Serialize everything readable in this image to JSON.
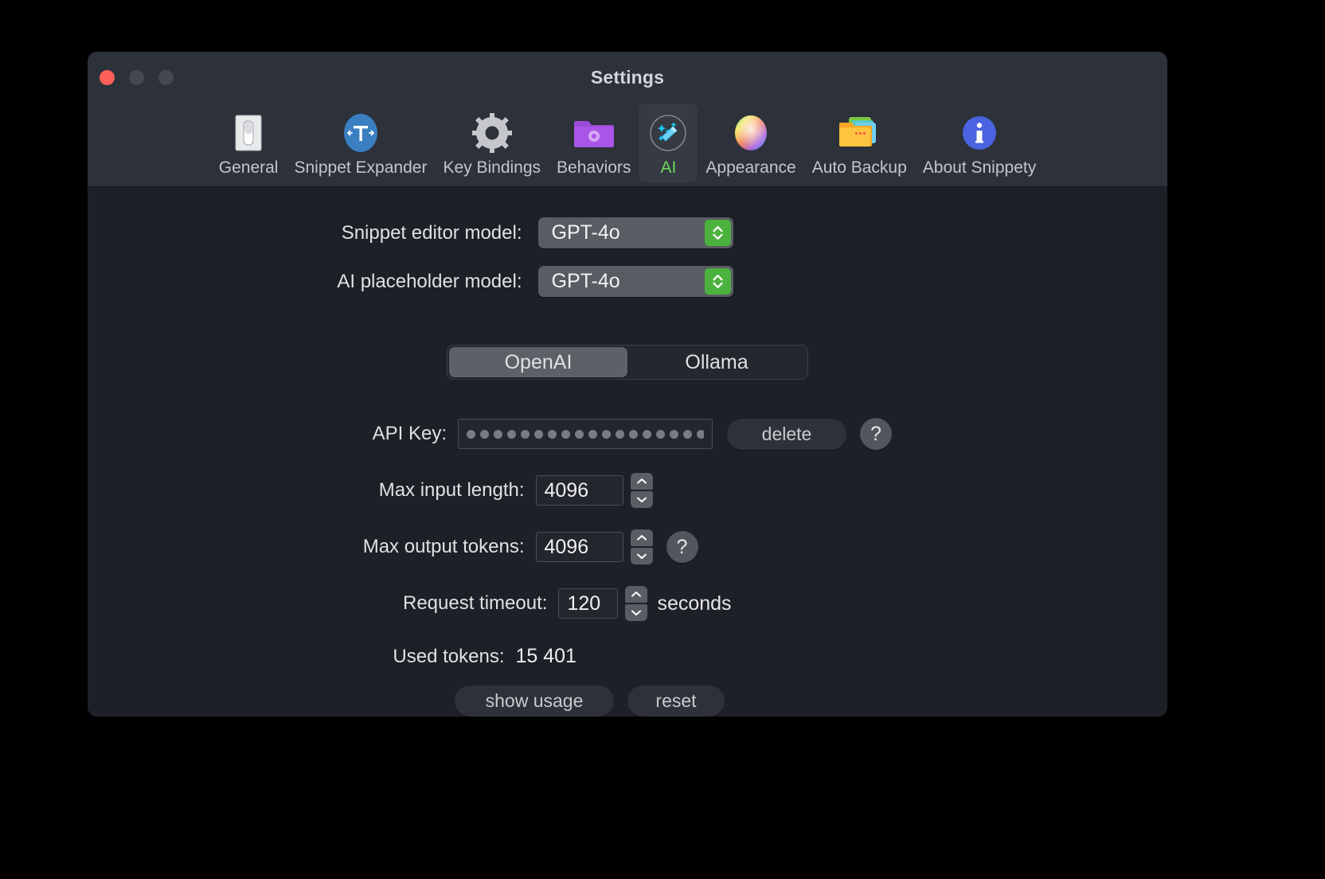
{
  "window": {
    "title": "Settings",
    "traffic_lights": [
      "close",
      "minimize",
      "maximize"
    ]
  },
  "toolbar": {
    "tabs": [
      {
        "label": "General",
        "icon": "toggle-switch-icon",
        "selected": false
      },
      {
        "label": "Snippet Expander",
        "icon": "text-expand-icon",
        "selected": false
      },
      {
        "label": "Key Bindings",
        "icon": "gear-icon",
        "selected": false
      },
      {
        "label": "Behaviors",
        "icon": "folder-gear-icon",
        "selected": false
      },
      {
        "label": "AI",
        "icon": "magic-wand-icon",
        "selected": true
      },
      {
        "label": "Appearance",
        "icon": "color-wheel-icon",
        "selected": false
      },
      {
        "label": "Auto Backup",
        "icon": "folder-stack-icon",
        "selected": false
      },
      {
        "label": "About Snippety",
        "icon": "info-icon",
        "selected": false
      }
    ]
  },
  "main": {
    "snippet_editor_model": {
      "label": "Snippet editor model:",
      "value": "GPT-4o"
    },
    "ai_placeholder_model": {
      "label": "AI placeholder model:",
      "value": "GPT-4o"
    },
    "provider_segments": [
      {
        "label": "OpenAI",
        "active": true
      },
      {
        "label": "Ollama",
        "active": false
      }
    ],
    "api_key": {
      "label": "API Key:",
      "masked_char_count": 22,
      "delete_label": "delete",
      "help_label": "?"
    },
    "max_input_length": {
      "label": "Max input length:",
      "value": "4096"
    },
    "max_output_tokens": {
      "label": "Max output tokens:",
      "value": "4096",
      "help_label": "?"
    },
    "request_timeout": {
      "label": "Request timeout:",
      "value": "120",
      "unit": "seconds"
    },
    "used_tokens": {
      "label": "Used tokens:",
      "value": "15 401"
    },
    "actions": {
      "show_usage_label": "show usage",
      "reset_label": "reset"
    }
  },
  "colors": {
    "window_bg": "#1e2027",
    "toolbar_bg": "#2c313a",
    "accent_green": "#4cb23f",
    "selected_tab_text": "#6ddb5a",
    "close_button": "#ff5f57"
  }
}
